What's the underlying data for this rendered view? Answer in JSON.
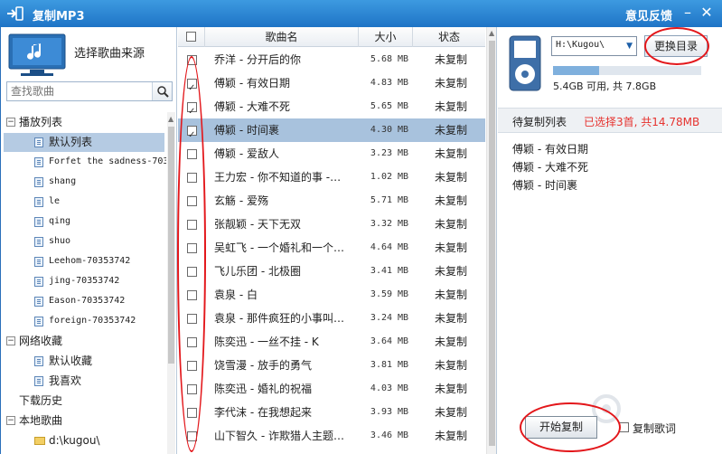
{
  "window": {
    "title": "复制MP3",
    "feedback": "意见反馈",
    "minimize": "–",
    "close": "✕"
  },
  "left": {
    "source_label": "选择歌曲来源",
    "search_placeholder": "查找歌曲",
    "tree": [
      {
        "type": "group",
        "label": "播放列表",
        "expander": "−"
      },
      {
        "type": "item",
        "label": "默认列表",
        "selected": true
      },
      {
        "type": "item",
        "label": "Forfet the sadness-703",
        "mono": true
      },
      {
        "type": "item",
        "label": "shang",
        "mono": true
      },
      {
        "type": "item",
        "label": "le",
        "mono": true
      },
      {
        "type": "item",
        "label": "qing",
        "mono": true
      },
      {
        "type": "item",
        "label": "shuo",
        "mono": true
      },
      {
        "type": "item",
        "label": "Leehom-70353742",
        "mono": true
      },
      {
        "type": "item",
        "label": "jing-70353742",
        "mono": true
      },
      {
        "type": "item",
        "label": "Eason-70353742",
        "mono": true
      },
      {
        "type": "item",
        "label": "foreign-70353742",
        "mono": true
      },
      {
        "type": "group",
        "label": "网络收藏",
        "expander": "−"
      },
      {
        "type": "item",
        "label": "默认收藏"
      },
      {
        "type": "item",
        "label": "我喜欢"
      },
      {
        "type": "plain",
        "label": "下载历史"
      },
      {
        "type": "group",
        "label": "本地歌曲",
        "expander": "−"
      },
      {
        "type": "folder",
        "label": "d:\\kugou\\"
      }
    ]
  },
  "table": {
    "headers": {
      "song": "歌曲名",
      "size": "大小",
      "status": "状态"
    },
    "rows": [
      {
        "song": "乔洋 - 分开后的你",
        "size": "5.68 MB",
        "status": "未复制",
        "checked": false,
        "selected": false
      },
      {
        "song": "傅颖 - 有效日期",
        "size": "4.83 MB",
        "status": "未复制",
        "checked": true,
        "selected": false
      },
      {
        "song": "傅颖 - 大难不死",
        "size": "5.65 MB",
        "status": "未复制",
        "checked": true,
        "selected": false
      },
      {
        "song": "傅颖 - 时间裹",
        "size": "4.30 MB",
        "status": "未复制",
        "checked": true,
        "selected": true
      },
      {
        "song": "傅颖 - 爱敌人",
        "size": "3.23 MB",
        "status": "未复制",
        "checked": false,
        "selected": false
      },
      {
        "song": "王力宏 - 你不知道的事 -…",
        "size": "1.02 MB",
        "status": "未复制",
        "checked": false,
        "selected": false
      },
      {
        "song": "玄觞 - 爱殇",
        "size": "5.71 MB",
        "status": "未复制",
        "checked": false,
        "selected": false
      },
      {
        "song": "张靓颖 - 天下无双",
        "size": "3.32 MB",
        "status": "未复制",
        "checked": false,
        "selected": false
      },
      {
        "song": "吴虹飞 - 一个婚礼和一个…",
        "size": "4.64 MB",
        "status": "未复制",
        "checked": false,
        "selected": false
      },
      {
        "song": "飞儿乐团 - 北极圈",
        "size": "3.41 MB",
        "status": "未复制",
        "checked": false,
        "selected": false
      },
      {
        "song": "袁泉 - 白",
        "size": "3.59 MB",
        "status": "未复制",
        "checked": false,
        "selected": false
      },
      {
        "song": "袁泉 - 那件疯狂的小事叫…",
        "size": "3.24 MB",
        "status": "未复制",
        "checked": false,
        "selected": false
      },
      {
        "song": "陈奕迅 - 一丝不挂 - K",
        "size": "3.64 MB",
        "status": "未复制",
        "checked": false,
        "selected": false
      },
      {
        "song": "饶雪漫 - 放手的勇气",
        "size": "3.81 MB",
        "status": "未复制",
        "checked": false,
        "selected": false
      },
      {
        "song": "陈奕迅 - 婚礼的祝福",
        "size": "4.03 MB",
        "status": "未复制",
        "checked": false,
        "selected": false
      },
      {
        "song": "李代沫 - 在我想起来",
        "size": "3.93 MB",
        "status": "未复制",
        "checked": false,
        "selected": false
      },
      {
        "song": "山下智久 - 诈欺猎人主题…",
        "size": "3.46 MB",
        "status": "未复制",
        "checked": false,
        "selected": false
      }
    ]
  },
  "right": {
    "directory": "H:\\Kugou\\",
    "change_dir": "更换目录",
    "storage_text": "5.4GB 可用, 共 7.8GB",
    "storage_used_fraction": 0.31,
    "pending_title": "待复制列表",
    "pending_count": "已选择3首, 共14.78MB",
    "pending_items": [
      "傅颖 - 有效日期",
      "傅颖 - 大难不死",
      "傅颖 - 时间裹"
    ],
    "start_button": "开始复制",
    "copy_lyrics": "复制歌词"
  },
  "colors": {
    "titlebar": "#2a82d4",
    "selected_row": "#a8c2dd",
    "accent_red": "#e6332f"
  }
}
